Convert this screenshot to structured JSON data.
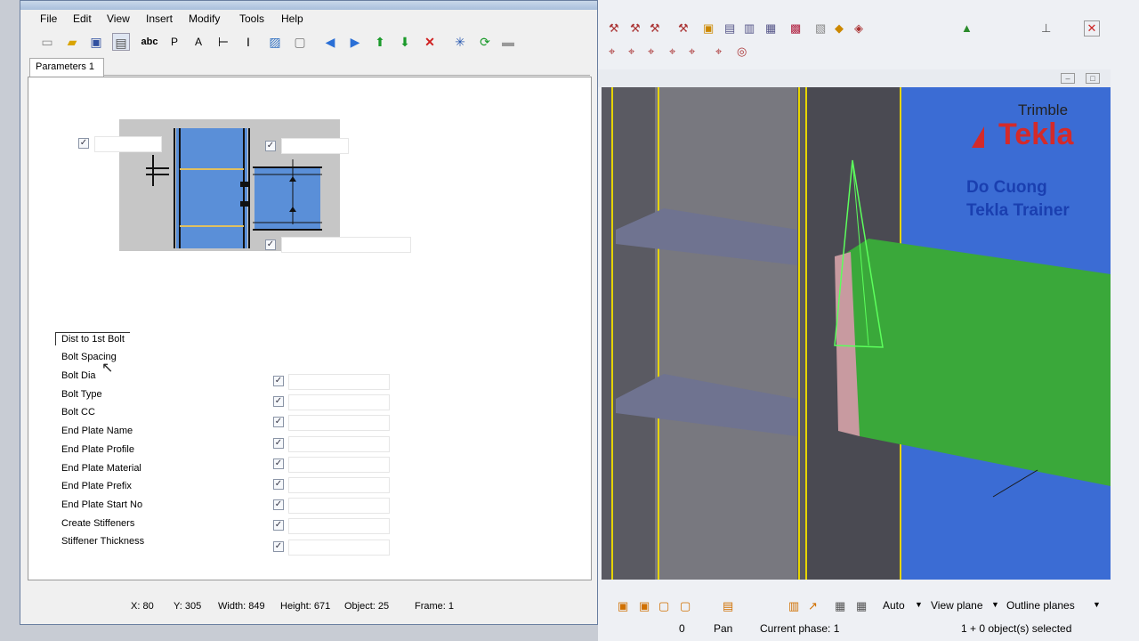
{
  "menu": [
    "File",
    "Edit",
    "View",
    "Insert",
    "Modify",
    "Tools",
    "Help"
  ],
  "tab_label": "Parameters 1",
  "params": [
    "Dist to 1st Bolt",
    "Bolt Spacing",
    "Bolt Dia",
    "Bolt Type",
    "Bolt CC",
    "End Plate Name",
    "End Plate Profile",
    "End Plate Material",
    "End Plate Prefix",
    "End Plate Start No",
    "Create Stiffeners",
    "Stiffener Thickness"
  ],
  "status": {
    "x": "X: 80",
    "y": "Y: 305",
    "width": "Width: 849",
    "height": "Height: 671",
    "object": "Object: 25",
    "frame": "Frame: 1"
  },
  "logo": {
    "brand_top": "Trimble",
    "brand": "Tekla",
    "author": "Do Cuong",
    "role": "Tekla Trainer"
  },
  "bottom_bar": {
    "auto": "Auto",
    "view_plane": "View plane",
    "outline": "Outline planes"
  },
  "right_status": {
    "zero": "0",
    "pan": "Pan",
    "phase": "Current phase: 1",
    "selected": "1 + 0 object(s) selected"
  },
  "colors": {
    "beam_green": "#3aa83a",
    "column_dark": "#4a4a55",
    "title_blue": "#1a3fb0",
    "logo_red": "#d42a2a"
  }
}
